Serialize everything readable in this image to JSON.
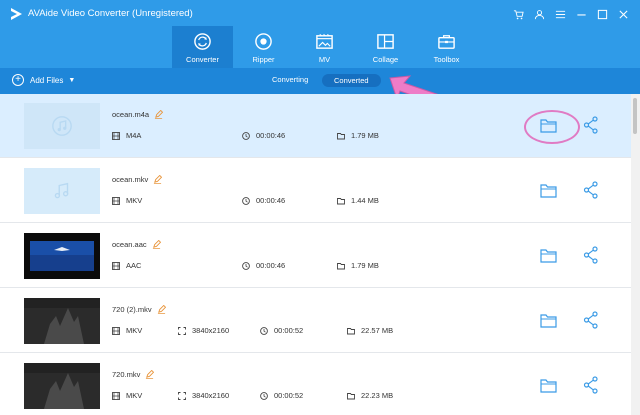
{
  "window": {
    "title": "AVAide Video Converter (Unregistered)",
    "controls": [
      "cart-icon",
      "user-icon",
      "menu-icon",
      "minimize-icon",
      "maximize-icon",
      "close-icon"
    ]
  },
  "nav": {
    "active": "Converter",
    "items": [
      {
        "label": "Converter",
        "icon": "converter-icon"
      },
      {
        "label": "Ripper",
        "icon": "ripper-icon"
      },
      {
        "label": "MV",
        "icon": "mv-icon"
      },
      {
        "label": "Collage",
        "icon": "collage-icon"
      },
      {
        "label": "Toolbox",
        "icon": "toolbox-icon"
      }
    ]
  },
  "toolbar": {
    "add_files": "Add Files",
    "tabs": [
      "Converting",
      "Converted"
    ],
    "active_tab": "Converted"
  },
  "files": [
    {
      "name": "ocean.m4a",
      "format": "M4A",
      "resolution": "",
      "duration": "00:00:46",
      "size": "1.79 MB",
      "thumb": "audio",
      "selected": true
    },
    {
      "name": "ocean.mkv",
      "format": "MKV",
      "resolution": "",
      "duration": "00:00:46",
      "size": "1.44 MB",
      "thumb": "audio",
      "selected": false
    },
    {
      "name": "ocean.aac",
      "format": "AAC",
      "resolution": "",
      "duration": "00:00:46",
      "size": "1.79 MB",
      "thumb": "video-blue",
      "selected": false
    },
    {
      "name": "720 (2).mkv",
      "format": "MKV",
      "resolution": "3840x2160",
      "duration": "00:00:52",
      "size": "22.57 MB",
      "thumb": "video-dark",
      "selected": false
    },
    {
      "name": "720.mkv",
      "format": "MKV",
      "resolution": "3840x2160",
      "duration": "00:00:52",
      "size": "22.23 MB",
      "thumb": "video-dark",
      "selected": false
    }
  ],
  "colors": {
    "header": "#2f9be8",
    "toolbar": "#1e86d9",
    "selected_row": "#dbeeff",
    "action_icon": "#3b9be6",
    "annotation": "#e07bc4"
  }
}
